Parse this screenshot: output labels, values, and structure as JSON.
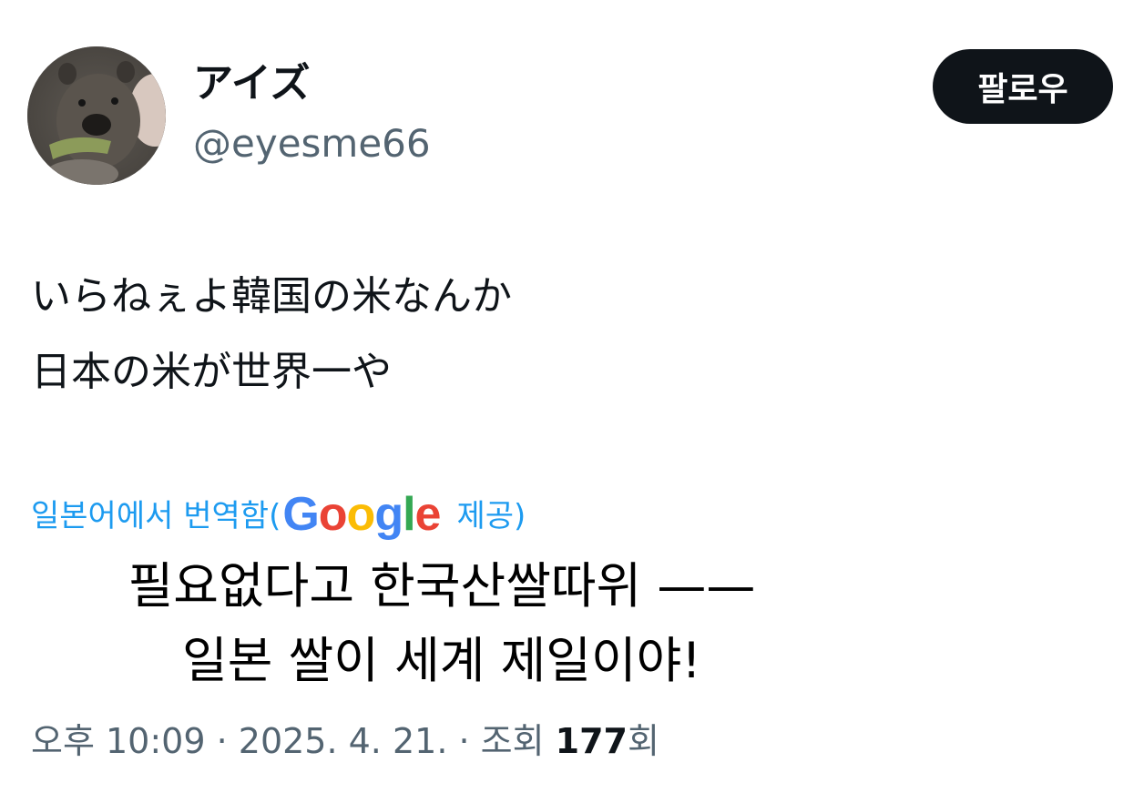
{
  "author": {
    "display_name": "アイズ",
    "handle": "@eyesme66"
  },
  "follow_button_label": "팔로우",
  "tweet": {
    "lines": [
      "いらねぇよ韓国の米なんか",
      "日本の米が世界一や"
    ]
  },
  "translation": {
    "label": "일본어에서 번역함",
    "open_paren": "(",
    "google_letters": [
      "G",
      "o",
      "o",
      "g",
      "l",
      "e"
    ],
    "provided": "제공",
    "close_paren": ")",
    "lines": [
      "필요없다고 한국산쌀따위 ——",
      "일본 쌀이 세계 제일이야!"
    ]
  },
  "meta": {
    "time": "오후 10:09",
    "separator": " · ",
    "date": "2025. 4. 21.",
    "views_label": "조회",
    "views_count": "177",
    "views_suffix": "회"
  },
  "icons": {
    "avatar": "capybara-photo-avatar",
    "google_logo": "google-logo"
  },
  "colors": {
    "accent_blue": "#1d9bf0",
    "text_primary": "#0f1419",
    "text_secondary": "#536471",
    "button_bg": "#0f1419",
    "google_blue": "#4285f4",
    "google_red": "#ea4335",
    "google_yellow": "#fbbc05",
    "google_green": "#34a853"
  }
}
